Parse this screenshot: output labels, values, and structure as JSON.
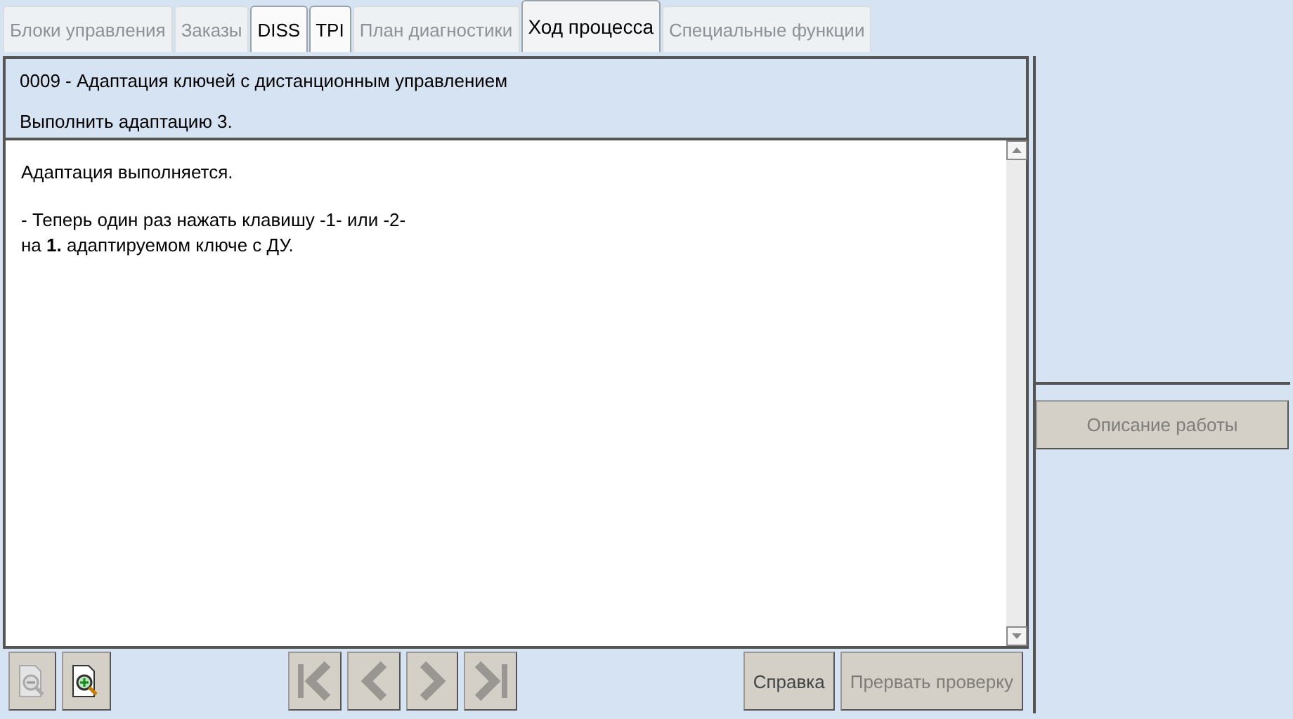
{
  "tabs": [
    {
      "label": "Блоки управления",
      "selected": false,
      "disabled": true
    },
    {
      "label": "Заказы",
      "selected": false,
      "disabled": true
    },
    {
      "label": "DISS",
      "selected": false,
      "disabled": false
    },
    {
      "label": "TPI",
      "selected": false,
      "disabled": false
    },
    {
      "label": "План диагностики",
      "selected": false,
      "disabled": true
    },
    {
      "label": "Ход процесса",
      "selected": true,
      "disabled": false
    },
    {
      "label": "Специальные функции",
      "selected": false,
      "disabled": true
    }
  ],
  "header": {
    "title": "0009 - Адаптация ключей с дистанционным управлением",
    "step": "Выполнить адаптацию 3."
  },
  "content": {
    "paragraphs": [
      "Адаптация выполняется.",
      "- Теперь один раз нажать клавишу -1- или -2-\nна **1.** адаптируемом ключе с ДУ."
    ]
  },
  "side": {
    "button": {
      "label": "Описание работы",
      "disabled": true
    }
  },
  "toolbar": {
    "zoom_buttons": [
      {
        "kind": "zoom-out",
        "disabled": true
      },
      {
        "kind": "zoom-in",
        "disabled": false
      }
    ],
    "nav_buttons": [
      {
        "kind": "first",
        "disabled": true
      },
      {
        "kind": "prev",
        "disabled": true
      },
      {
        "kind": "next",
        "disabled": true
      },
      {
        "kind": "last",
        "disabled": true
      }
    ],
    "buttons": [
      {
        "label": "Справка",
        "disabled": false
      },
      {
        "label": "Прервать проверку",
        "disabled": true
      }
    ]
  }
}
